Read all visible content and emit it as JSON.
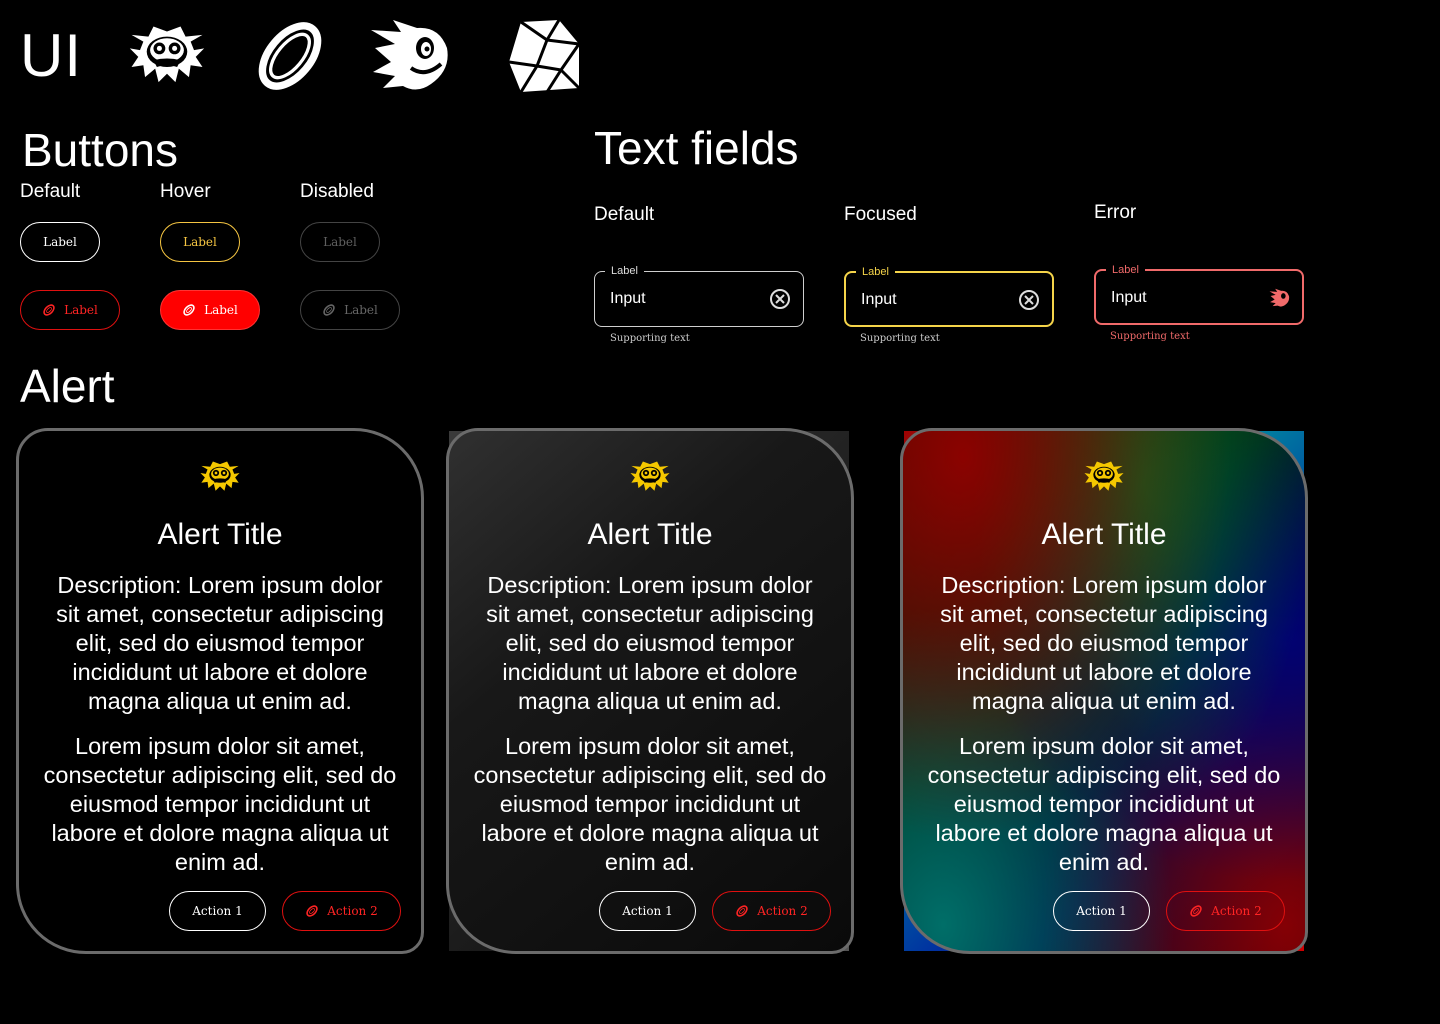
{
  "header": {
    "title": "UI",
    "icons": [
      "robotnik-emblem-icon",
      "ring-icon",
      "sonic-head-icon",
      "chaos-emerald-icon"
    ]
  },
  "buttons": {
    "heading": "Buttons",
    "columns": [
      "Default",
      "Hover",
      "Disabled"
    ],
    "label": "Label"
  },
  "text_fields": {
    "heading": "Text fields",
    "columns": [
      "Default",
      "Focused",
      "Error"
    ],
    "label": "Label",
    "value": "Input",
    "supporting_text": "Supporting text"
  },
  "alert": {
    "heading": "Alert",
    "title": "Alert Title",
    "description": "Description: Lorem ipsum dolor sit amet, consectetur adipiscing elit, sed do eiusmod tempor incididunt ut labore et dolore magna aliqua ut enim ad.",
    "body": "Lorem ipsum dolor sit amet, consectetur adipiscing elit, sed do eiusmod tempor incididunt ut labore et dolore magna aliqua ut enim ad.",
    "action1": "Action 1",
    "action2": "Action 2"
  },
  "colors": {
    "hover_accent": "#f5c542",
    "danger": "#ff0000",
    "error": "#f06a6a",
    "disabled": "#444444",
    "card_border": "#6b6b6b",
    "logo_yellow": "#f5c800"
  }
}
